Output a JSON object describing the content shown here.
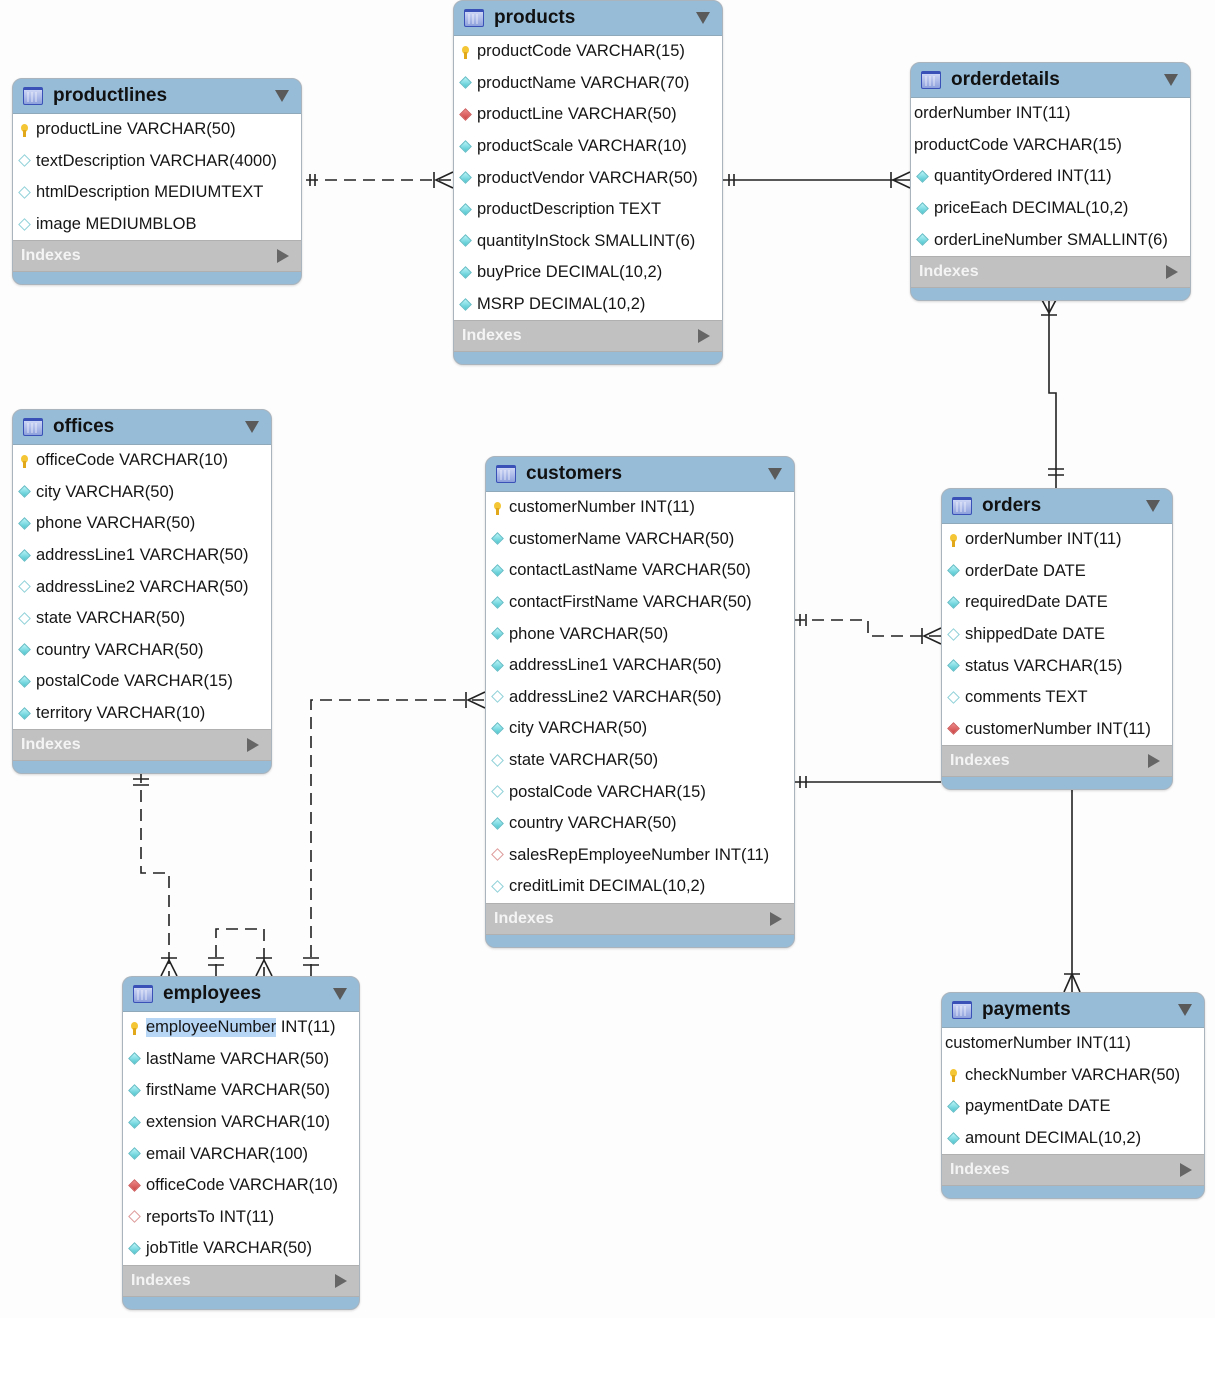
{
  "diagram": {
    "type": "EER diagram",
    "tables": [
      {
        "id": "productlines",
        "name": "productlines",
        "indexes_label": "Indexes",
        "columns": [
          {
            "kind": "pk",
            "text": "productLine VARCHAR(50)"
          },
          {
            "kind": "null",
            "text": "textDescription VARCHAR(4000)"
          },
          {
            "kind": "null",
            "text": "htmlDescription MEDIUMTEXT"
          },
          {
            "kind": "null",
            "text": "image MEDIUMBLOB"
          }
        ]
      },
      {
        "id": "products",
        "name": "products",
        "indexes_label": "Indexes",
        "columns": [
          {
            "kind": "pk",
            "text": "productCode VARCHAR(15)"
          },
          {
            "kind": "nn",
            "text": "productName VARCHAR(70)"
          },
          {
            "kind": "fk-nn",
            "text": "productLine VARCHAR(50)"
          },
          {
            "kind": "nn",
            "text": "productScale VARCHAR(10)"
          },
          {
            "kind": "nn",
            "text": "productVendor VARCHAR(50)"
          },
          {
            "kind": "nn",
            "text": "productDescription TEXT"
          },
          {
            "kind": "nn",
            "text": "quantityInStock SMALLINT(6)"
          },
          {
            "kind": "nn",
            "text": "buyPrice DECIMAL(10,2)"
          },
          {
            "kind": "nn",
            "text": "MSRP DECIMAL(10,2)"
          }
        ]
      },
      {
        "id": "orderdetails",
        "name": "orderdetails",
        "indexes_label": "Indexes",
        "columns": [
          {
            "kind": "none",
            "text": "orderNumber INT(11)"
          },
          {
            "kind": "none",
            "text": "productCode VARCHAR(15)"
          },
          {
            "kind": "nn",
            "text": "quantityOrdered INT(11)"
          },
          {
            "kind": "nn",
            "text": "priceEach DECIMAL(10,2)"
          },
          {
            "kind": "nn",
            "text": "orderLineNumber SMALLINT(6)"
          }
        ]
      },
      {
        "id": "offices",
        "name": "offices",
        "indexes_label": "Indexes",
        "columns": [
          {
            "kind": "pk",
            "text": "officeCode VARCHAR(10)"
          },
          {
            "kind": "nn",
            "text": "city VARCHAR(50)"
          },
          {
            "kind": "nn",
            "text": "phone VARCHAR(50)"
          },
          {
            "kind": "nn",
            "text": "addressLine1 VARCHAR(50)"
          },
          {
            "kind": "null",
            "text": "addressLine2 VARCHAR(50)"
          },
          {
            "kind": "null",
            "text": "state VARCHAR(50)"
          },
          {
            "kind": "nn",
            "text": "country VARCHAR(50)"
          },
          {
            "kind": "nn",
            "text": "postalCode VARCHAR(15)"
          },
          {
            "kind": "nn",
            "text": "territory VARCHAR(10)"
          }
        ]
      },
      {
        "id": "customers",
        "name": "customers",
        "indexes_label": "Indexes",
        "columns": [
          {
            "kind": "pk",
            "text": "customerNumber INT(11)"
          },
          {
            "kind": "nn",
            "text": "customerName VARCHAR(50)"
          },
          {
            "kind": "nn",
            "text": "contactLastName VARCHAR(50)"
          },
          {
            "kind": "nn",
            "text": "contactFirstName VARCHAR(50)"
          },
          {
            "kind": "nn",
            "text": "phone VARCHAR(50)"
          },
          {
            "kind": "nn",
            "text": "addressLine1 VARCHAR(50)"
          },
          {
            "kind": "null",
            "text": "addressLine2 VARCHAR(50)"
          },
          {
            "kind": "nn",
            "text": "city VARCHAR(50)"
          },
          {
            "kind": "null",
            "text": "state VARCHAR(50)"
          },
          {
            "kind": "null",
            "text": "postalCode VARCHAR(15)"
          },
          {
            "kind": "nn",
            "text": "country VARCHAR(50)"
          },
          {
            "kind": "fk-null",
            "text": "salesRepEmployeeNumber INT(11)"
          },
          {
            "kind": "null",
            "text": "creditLimit DECIMAL(10,2)"
          }
        ]
      },
      {
        "id": "orders",
        "name": "orders",
        "indexes_label": "Indexes",
        "columns": [
          {
            "kind": "pk",
            "text": "orderNumber INT(11)"
          },
          {
            "kind": "nn",
            "text": "orderDate DATE"
          },
          {
            "kind": "nn",
            "text": "requiredDate DATE"
          },
          {
            "kind": "null",
            "text": "shippedDate DATE"
          },
          {
            "kind": "nn",
            "text": "status VARCHAR(15)"
          },
          {
            "kind": "null",
            "text": "comments TEXT"
          },
          {
            "kind": "fk-nn",
            "text": "customerNumber INT(11)"
          }
        ]
      },
      {
        "id": "employees",
        "name": "employees",
        "indexes_label": "Indexes",
        "columns": [
          {
            "kind": "pk",
            "text": "employeeNumber",
            "suffix": " INT(11)",
            "selected": true
          },
          {
            "kind": "nn",
            "text": "lastName VARCHAR(50)"
          },
          {
            "kind": "nn",
            "text": "firstName VARCHAR(50)"
          },
          {
            "kind": "nn",
            "text": "extension VARCHAR(10)"
          },
          {
            "kind": "nn",
            "text": "email VARCHAR(100)"
          },
          {
            "kind": "fk-nn",
            "text": "officeCode VARCHAR(10)"
          },
          {
            "kind": "fk-null",
            "text": "reportsTo INT(11)"
          },
          {
            "kind": "nn",
            "text": "jobTitle VARCHAR(50)"
          }
        ]
      },
      {
        "id": "payments",
        "name": "payments",
        "indexes_label": "Indexes",
        "columns": [
          {
            "kind": "none",
            "text": "customerNumber INT(11)"
          },
          {
            "kind": "pk",
            "text": "checkNumber VARCHAR(50)"
          },
          {
            "kind": "nn",
            "text": "paymentDate DATE"
          },
          {
            "kind": "nn",
            "text": "amount DECIMAL(10,2)"
          }
        ]
      }
    ],
    "relationships": [
      {
        "from": "productlines",
        "to": "products",
        "style": "dashed",
        "from_card": "one-and-only-one",
        "to_card": "one-or-many"
      },
      {
        "from": "products",
        "to": "orderdetails",
        "style": "solid",
        "from_card": "one-and-only-one",
        "to_card": "one-or-many"
      },
      {
        "from": "orders",
        "to": "orderdetails",
        "style": "solid",
        "from_card": "one-and-only-one",
        "to_card": "one-or-many"
      },
      {
        "from": "customers",
        "to": "orders",
        "style": "dashed",
        "from_card": "one-and-only-one",
        "to_card": "one-or-many"
      },
      {
        "from": "customers",
        "to": "payments",
        "style": "solid",
        "from_card": "one-and-only-one",
        "to_card": "one-or-many"
      },
      {
        "from": "employees",
        "to": "customers",
        "style": "dashed",
        "from_card": "one-and-only-one",
        "to_card": "one-or-many"
      },
      {
        "from": "offices",
        "to": "employees",
        "style": "dashed",
        "from_card": "one-and-only-one",
        "to_card": "one-or-many"
      },
      {
        "from": "employees",
        "to": "employees",
        "style": "dashed",
        "from_card": "one-and-only-one",
        "to_card": "one-or-many"
      }
    ],
    "colors": {
      "table_header": "#96bcd8",
      "indexes_bar": "#c1c1c1",
      "selection": "#b7d5f5",
      "pk_key": "#f4c534",
      "nn_diamond": "#4fc6cf",
      "fk_diamond": "#c44444"
    }
  }
}
